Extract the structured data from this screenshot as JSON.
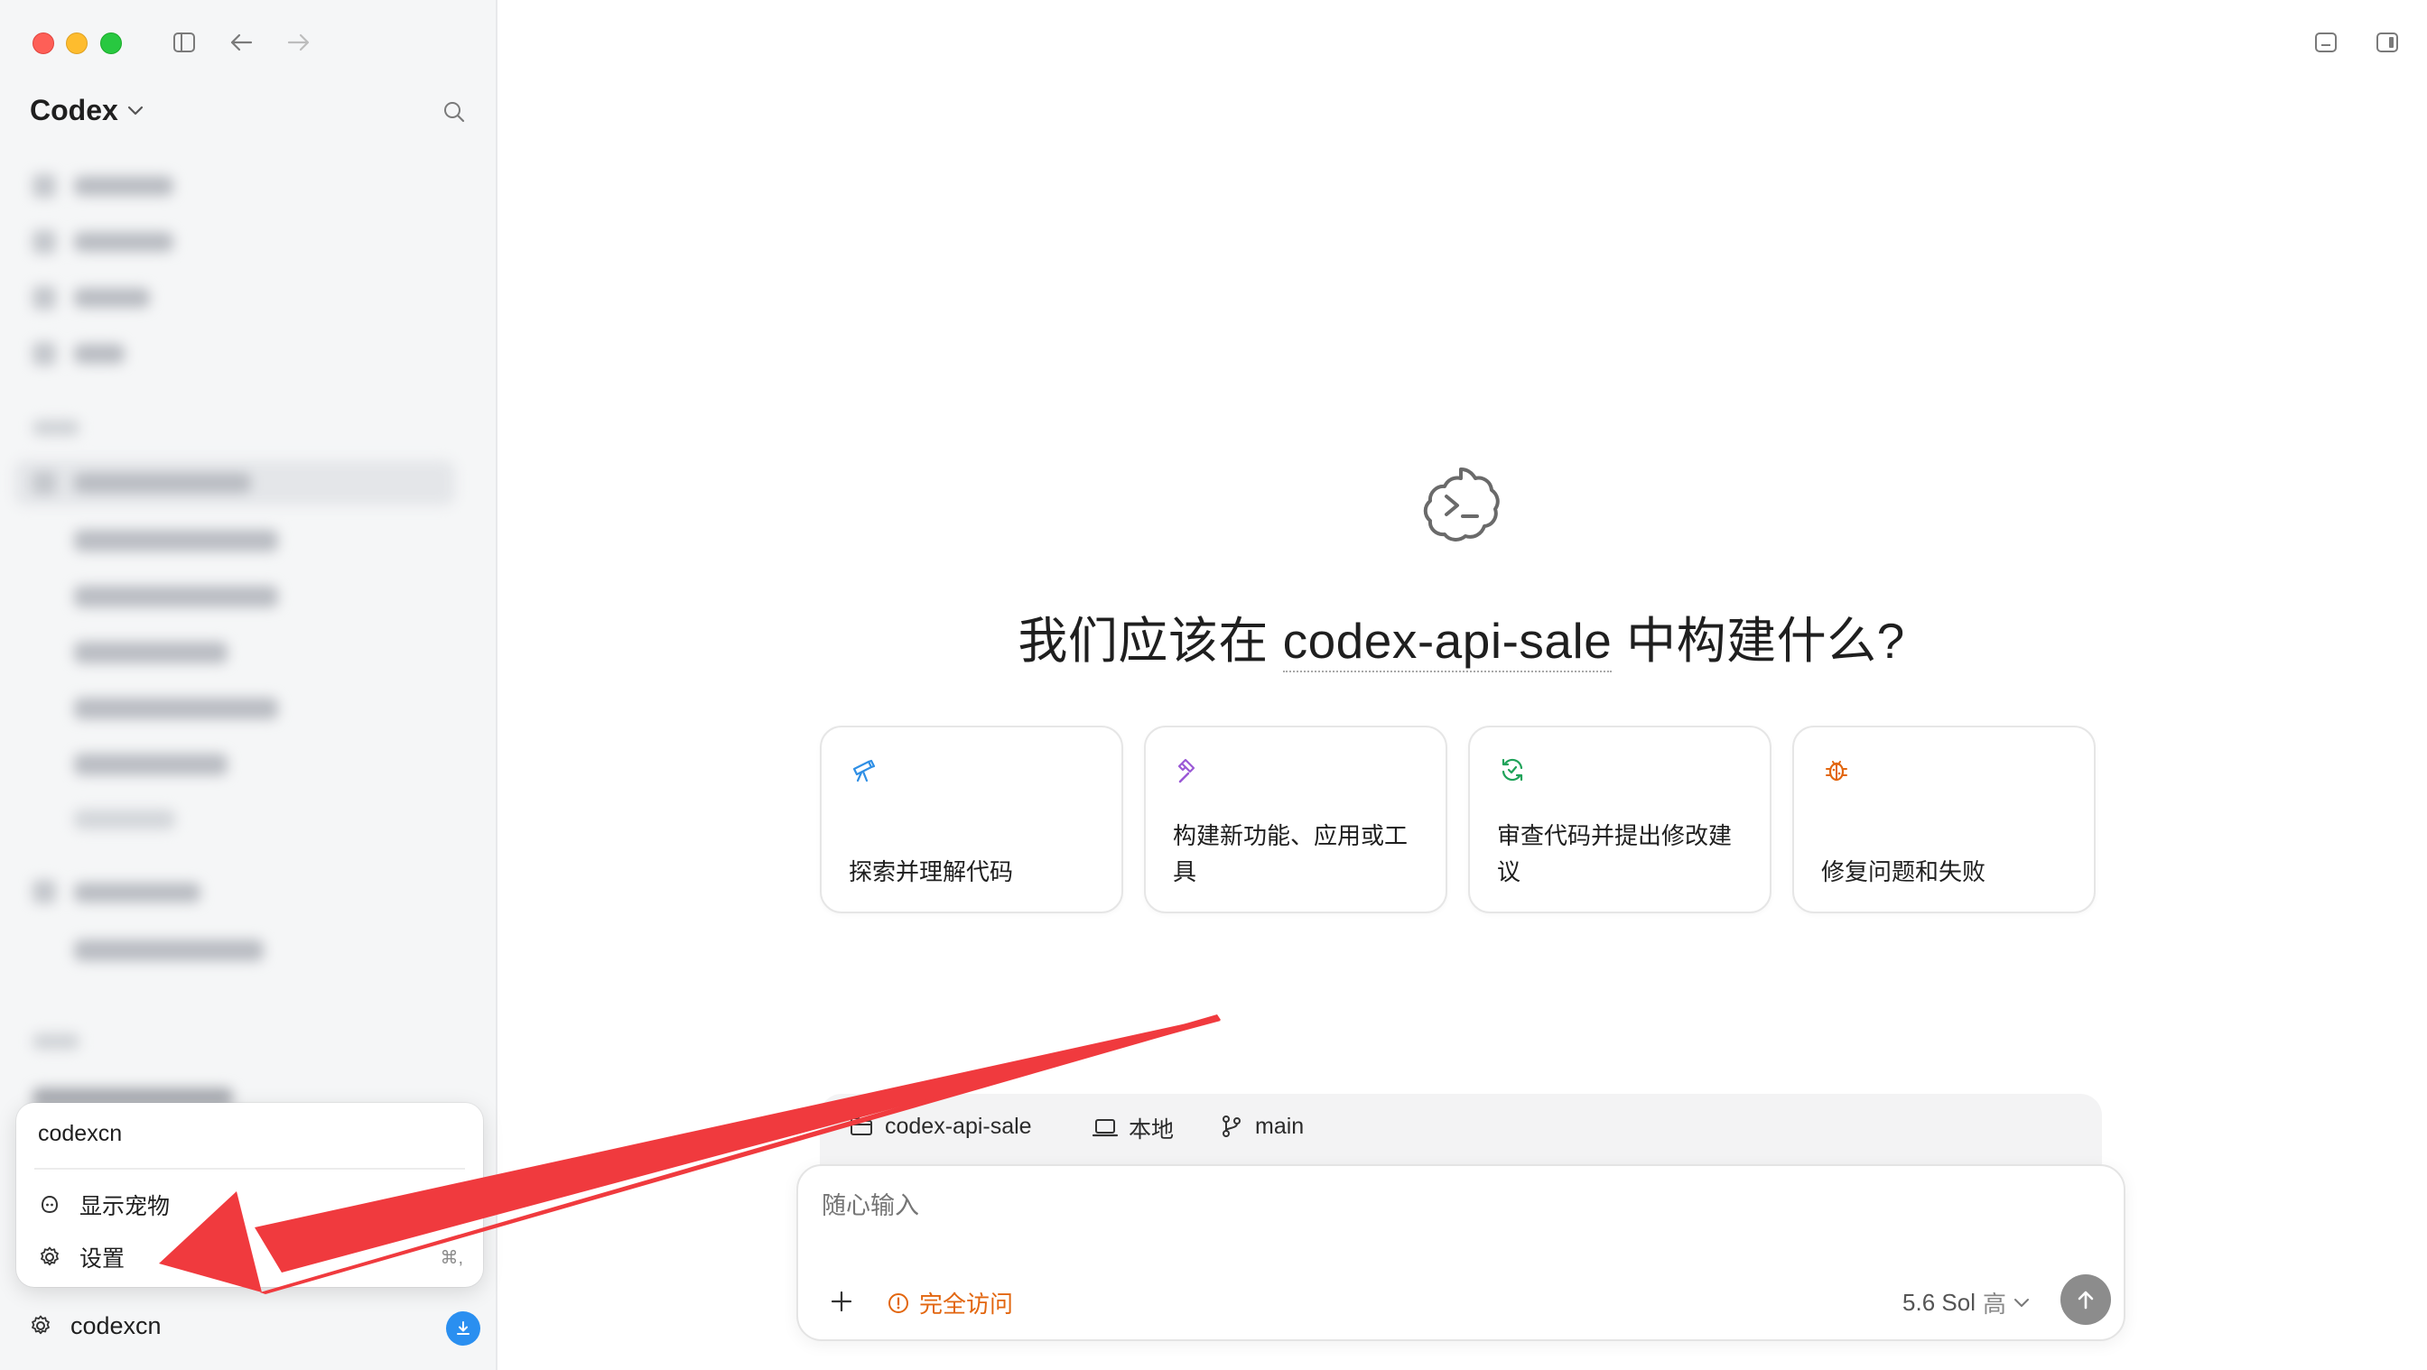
{
  "sidebar": {
    "app_name": "Codex",
    "popup": {
      "username": "codexcn",
      "items": [
        {
          "label": "显示宠物",
          "shortcut": ""
        },
        {
          "label": "设置",
          "shortcut": "⌘,"
        }
      ]
    },
    "footer": {
      "username": "codexcn"
    }
  },
  "main": {
    "headline_prefix": "我们应该在 ",
    "project": "codex-api-sale",
    "headline_suffix": " 中构建什么?",
    "cards": [
      {
        "label": "探索并理解代码",
        "icon": "telescope-icon",
        "color": "#2f8fe5"
      },
      {
        "label": "构建新功能、应用或工具",
        "icon": "hammer-icon",
        "color": "#9b59d6"
      },
      {
        "label": "审查代码并提出修改建议",
        "icon": "review-icon",
        "color": "#20a35a"
      },
      {
        "label": "修复问题和失败",
        "icon": "bug-icon",
        "color": "#e2660f"
      }
    ],
    "context": {
      "folder": "codex-api-sale",
      "environment": "本地",
      "branch": "main"
    },
    "composer": {
      "placeholder": "随心输入",
      "access_label": "完全访问",
      "model_label": "5.6 Sol",
      "effort_label": "高"
    }
  },
  "colors": {
    "accent_blue": "#2a8ff0",
    "warning_orange": "#e2660f",
    "annotation_arrow": "#f03a3e"
  }
}
